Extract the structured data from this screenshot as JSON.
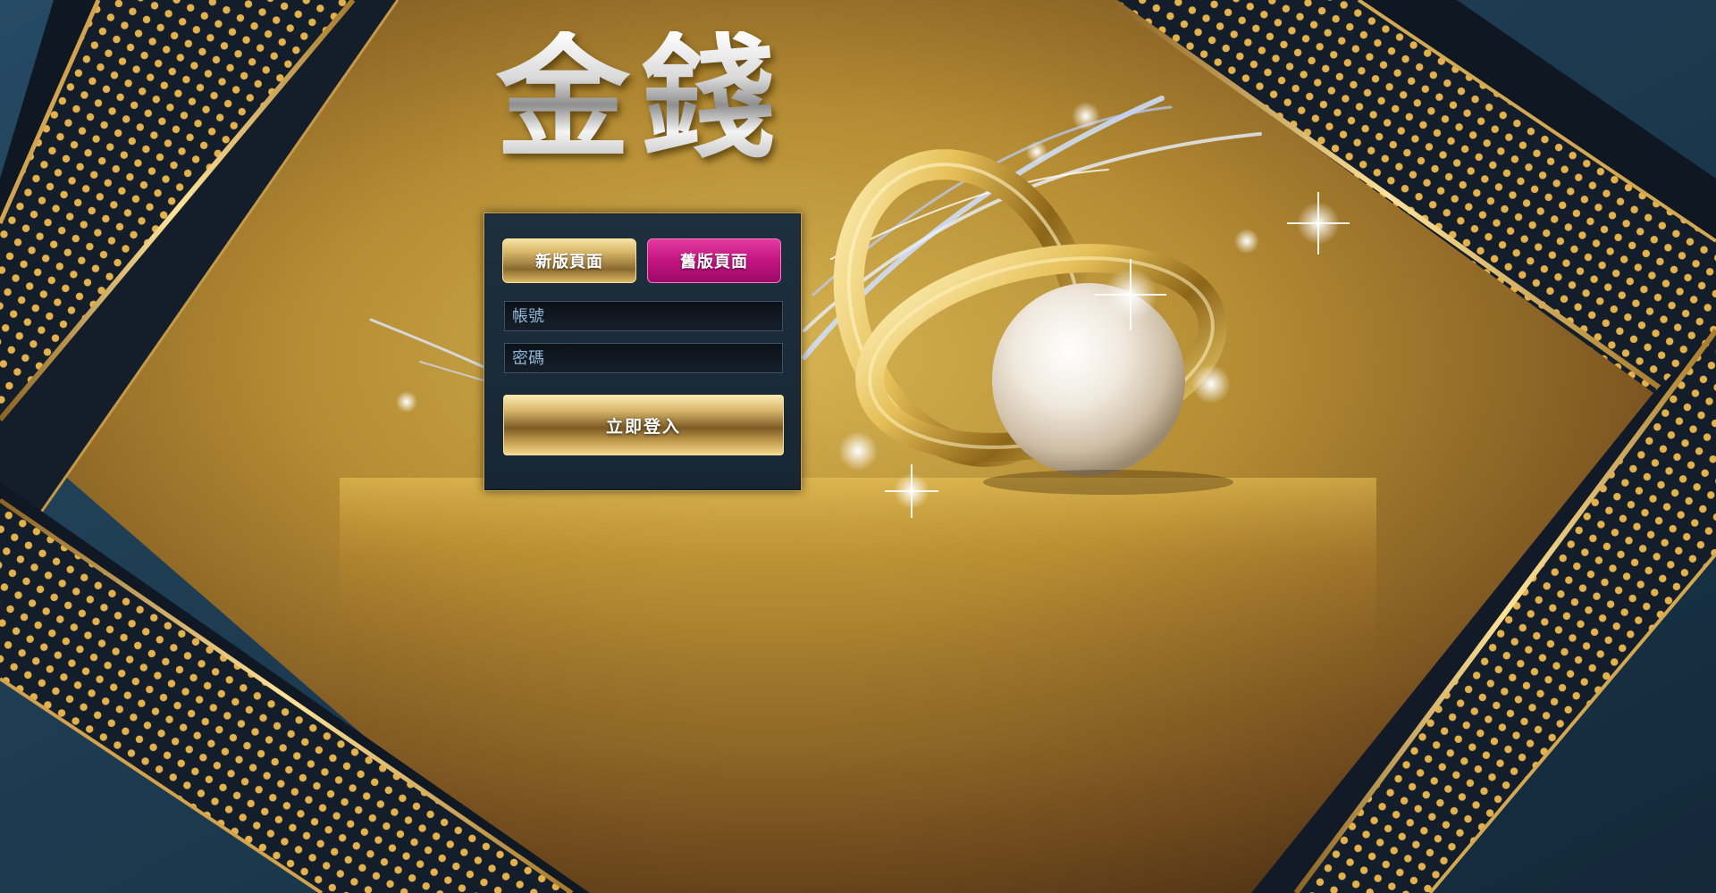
{
  "logo": {
    "text": "金錢"
  },
  "tabs": {
    "new_label": "新版頁面",
    "old_label": "舊版頁面"
  },
  "form": {
    "account_placeholder": "帳號",
    "password_placeholder": "密碼",
    "submit_label": "立即登入"
  },
  "colors": {
    "background_dark": "#1d3547",
    "gold": "#c9a25a",
    "active_tab": "#c21480",
    "panel": "#1b2b39",
    "field_text": "#8fb6d6"
  }
}
